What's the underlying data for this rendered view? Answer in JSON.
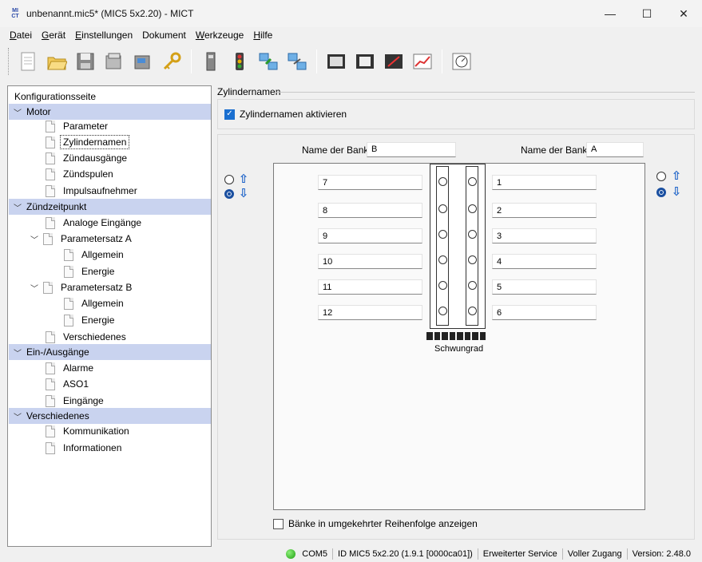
{
  "window": {
    "title": "unbenannt.mic5* (MIC5 5x2.20) - MICT",
    "icon_text_top": "MI",
    "icon_text_bottom": "CT",
    "minimize": "—",
    "maximize": "☐",
    "close": "✕"
  },
  "menu": [
    {
      "key": "D",
      "rest": "atei"
    },
    {
      "key": "G",
      "rest": "erät"
    },
    {
      "key": "E",
      "rest": "instellungen"
    },
    {
      "key": "",
      "rest": "Dokument"
    },
    {
      "key": "W",
      "rest": "erkzeuge"
    },
    {
      "key": "H",
      "rest": "ilfe"
    }
  ],
  "toolbar": {
    "icons": [
      "new-document-icon",
      "open-folder-icon",
      "save-icon",
      "read-device-icon",
      "write-device-icon",
      "key-icon",
      "device-icon",
      "traffic-light-icon",
      "connect-icon",
      "disconnect-icon",
      "monitor-icon",
      "scroll-icon",
      "oscilloscope-icon",
      "chart-icon",
      "gauge-icon"
    ]
  },
  "tree": {
    "header": "Konfigurationsseite",
    "rows": [
      {
        "label": "Motor",
        "type": "section"
      },
      {
        "label": "Parameter",
        "type": "page",
        "level": 1
      },
      {
        "label": "Zylindernamen",
        "type": "page",
        "level": 1,
        "selected": true
      },
      {
        "label": "Zündausgänge",
        "type": "page",
        "level": 1
      },
      {
        "label": "Zündspulen",
        "type": "page",
        "level": 1
      },
      {
        "label": "Impulsaufnehmer",
        "type": "page",
        "level": 1
      },
      {
        "label": "Zündzeitpunkt",
        "type": "section"
      },
      {
        "label": "Analoge Eingänge",
        "type": "page",
        "level": 1
      },
      {
        "label": "Parametersatz A",
        "type": "folder",
        "level": 1
      },
      {
        "label": "Allgemein",
        "type": "page",
        "level": 2
      },
      {
        "label": "Energie",
        "type": "page",
        "level": 2
      },
      {
        "label": "Parametersatz B",
        "type": "folder",
        "level": 1
      },
      {
        "label": "Allgemein",
        "type": "page",
        "level": 2
      },
      {
        "label": "Energie",
        "type": "page",
        "level": 2
      },
      {
        "label": "Verschiedenes",
        "type": "page",
        "level": 1
      },
      {
        "label": "Ein-/Ausgänge",
        "type": "section"
      },
      {
        "label": "Alarme",
        "type": "page",
        "level": 1
      },
      {
        "label": "ASO1",
        "type": "page",
        "level": 1
      },
      {
        "label": "Eingänge",
        "type": "page",
        "level": 1
      },
      {
        "label": "Verschiedenes",
        "type": "section"
      },
      {
        "label": "Kommunikation",
        "type": "page",
        "level": 1
      },
      {
        "label": "Informationen",
        "type": "page",
        "level": 1
      }
    ]
  },
  "page": {
    "group_title": "Zylindernamen",
    "enable_label": "Zylindernamen aktivieren",
    "enable_checked": true,
    "bank_label_left": "Name der Bank:",
    "bank_value_left": "B",
    "bank_label_right": "Name der Bank:",
    "bank_value_right": "A",
    "left_cylinders": [
      "7",
      "8",
      "9",
      "10",
      "11",
      "12"
    ],
    "right_cylinders": [
      "1",
      "2",
      "3",
      "4",
      "5",
      "6"
    ],
    "flywheel_label": "Schwungrad",
    "left_radio_up_selected": false,
    "left_radio_down_selected": true,
    "right_radio_up_selected": false,
    "right_radio_down_selected": true,
    "reverse_label": "Bänke in umgekehrter Reihenfolge anzeigen",
    "reverse_checked": false,
    "arrow_up": "⇧",
    "arrow_down": "⇩"
  },
  "status": {
    "connection_status": "connected",
    "port": "COM5",
    "id": "ID MIC5 5x2.20 (1.9.1 [0000ca01])",
    "service": "Erweiterter Service",
    "access": "Voller Zugang",
    "version": "Version: 2.48.0"
  }
}
